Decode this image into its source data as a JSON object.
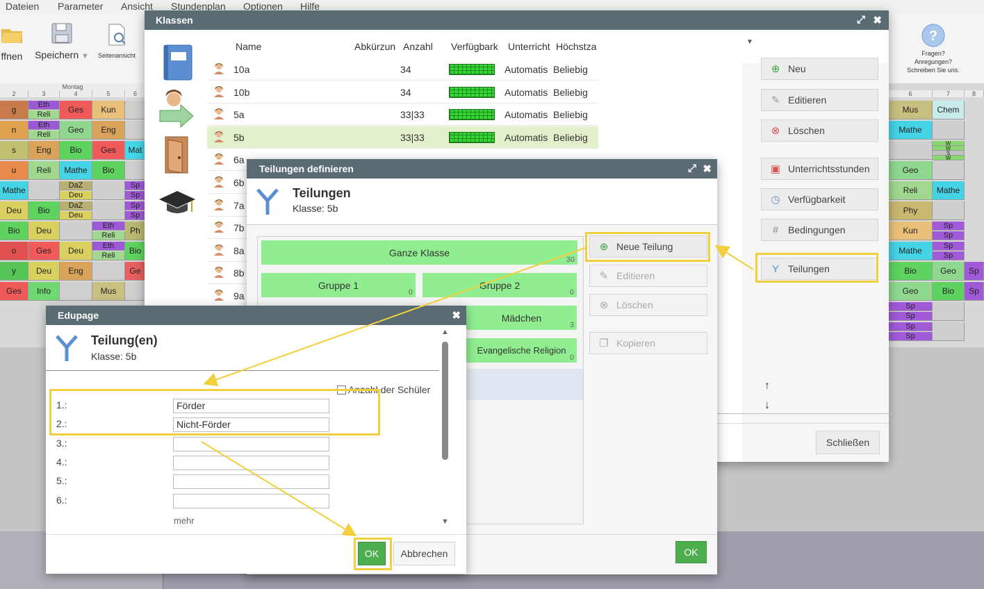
{
  "menubar": [
    "Dateien",
    "Parameter",
    "Ansicht",
    "Stundenplan",
    "Optionen",
    "Hilfe"
  ],
  "toolbar": {
    "open_label": "ffnen",
    "save_label": "Speichern",
    "preview_label": "Seitenansicht",
    "help_lines": [
      "Fragen?",
      "Anregungen?",
      "Schreiben Sie uns."
    ]
  },
  "timetable": {
    "day_label": "Montag",
    "left_headers": [
      "2",
      "3",
      "4",
      "5",
      "6"
    ],
    "right_headers": [
      "6",
      "7",
      "8"
    ],
    "left_cells": [
      [
        "g",
        "Eth|Reli",
        "Ges",
        "Kun",
        ""
      ],
      [
        "n",
        "Eth|Reli",
        "Geo",
        "Eng",
        ""
      ],
      [
        "s",
        "Eng",
        "Bio",
        "Ges",
        "Mat"
      ],
      [
        "u",
        "Reli",
        "Mathe",
        "Bio",
        ""
      ],
      [
        "Mathe",
        "",
        "DaZ|Deu",
        "",
        "Sp|Sp"
      ],
      [
        "Deu",
        "Bio",
        "DaZ|Deu",
        "",
        "Sp|Sp"
      ],
      [
        "Bio",
        "Deu",
        "",
        "Eth|Reli",
        "Ph"
      ],
      [
        "o",
        "Ges",
        "Deu",
        "Eth|Reli",
        "Bio"
      ],
      [
        "y",
        "Deu",
        "Eng",
        "",
        "Ge"
      ],
      [
        "Ges",
        "Info",
        "",
        "Mus",
        ""
      ]
    ],
    "right_cells": [
      [
        "Mus",
        "Chem"
      ],
      [
        "Mathe",
        ""
      ],
      [
        "",
        "W|W|S|W"
      ],
      [
        "Geo",
        ""
      ],
      [
        "Reli",
        "Mathe"
      ],
      [
        "Phy",
        ""
      ],
      [
        "Kun",
        "Sp|Sp"
      ],
      [
        "Mathe",
        "Sp|Sp"
      ],
      [
        "Bio",
        "Geo",
        "Sp"
      ],
      [
        "Geo",
        "Bio",
        "Sp"
      ],
      [
        "Sp|Sp",
        ""
      ],
      [
        "Sp|Sp",
        ""
      ]
    ]
  },
  "klassen": {
    "title": "Klassen",
    "columns": [
      "Name",
      "Abkürzun",
      "Anzahl",
      "Verfügbark",
      "Unterricht",
      "Höchstza"
    ],
    "rows": [
      {
        "name": "10a",
        "count": "34",
        "unterricht": "Automatis",
        "max": "Beliebig"
      },
      {
        "name": "10b",
        "count": "34",
        "unterricht": "Automatis",
        "max": "Beliebig"
      },
      {
        "name": "5a",
        "count": "33|33",
        "unterricht": "Automatis",
        "max": "Beliebig"
      },
      {
        "name": "5b",
        "count": "33|33",
        "unterricht": "Automatis",
        "max": "Beliebig"
      },
      {
        "name": "6a",
        "count": "",
        "unterricht": "",
        "max": ""
      },
      {
        "name": "6b",
        "count": "",
        "unterricht": "",
        "max": ""
      },
      {
        "name": "7a",
        "count": "",
        "unterricht": "",
        "max": ""
      },
      {
        "name": "7b",
        "count": "",
        "unterricht": "",
        "max": ""
      },
      {
        "name": "8a",
        "count": "",
        "unterricht": "",
        "max": ""
      },
      {
        "name": "8b",
        "count": "",
        "unterricht": "",
        "max": ""
      },
      {
        "name": "9a",
        "count": "",
        "unterricht": "",
        "max": ""
      }
    ],
    "buttons": {
      "neu": "Neu",
      "editieren": "Editieren",
      "loeschen": "Löschen",
      "unterrichtsstunden": "Unterrichtsstunden",
      "verfuegbarkeit": "Verfügbarkeit",
      "bedingungen": "Bedingungen",
      "teilungen": "Teilungen",
      "schliessen": "Schließen"
    }
  },
  "teilungen": {
    "title": "Teilungen definieren",
    "heading": "Teilungen",
    "subheading": "Klasse: 5b",
    "groups": [
      {
        "label": "Ganze Klasse",
        "count": "30"
      },
      {
        "label": "Gruppe 1",
        "count": "0"
      },
      {
        "label": "Gruppe 2",
        "count": "0"
      },
      {
        "label": "Mädchen",
        "count": "3"
      },
      {
        "label": "Evangelische Religion",
        "count": "0"
      }
    ],
    "buttons": {
      "neue_teilung": "Neue Teilung",
      "editieren": "Editieren",
      "loeschen": "Löschen",
      "kopieren": "Kopieren",
      "ok": "OK"
    }
  },
  "edupage": {
    "title": "Edupage",
    "heading": "Teilung(en)",
    "subheading": "Klasse: 5b",
    "checkbox_label": "Anzahl der Schüler",
    "fields": [
      {
        "label": "1.:",
        "value": "Förder"
      },
      {
        "label": "2.:",
        "value": "Nicht-Förder"
      },
      {
        "label": "3.:",
        "value": ""
      },
      {
        "label": "4.:",
        "value": ""
      },
      {
        "label": "5.:",
        "value": ""
      },
      {
        "label": "6.:",
        "value": ""
      }
    ],
    "more": "mehr",
    "ok": "OK",
    "cancel": "Abbrechen"
  },
  "colors": {
    "title_bar": "#5a6b74",
    "highlight": "#f2cf3c",
    "group_green": "#90ee90",
    "ok_green": "#4cae4c",
    "selected_row": "#e2f0cb"
  }
}
